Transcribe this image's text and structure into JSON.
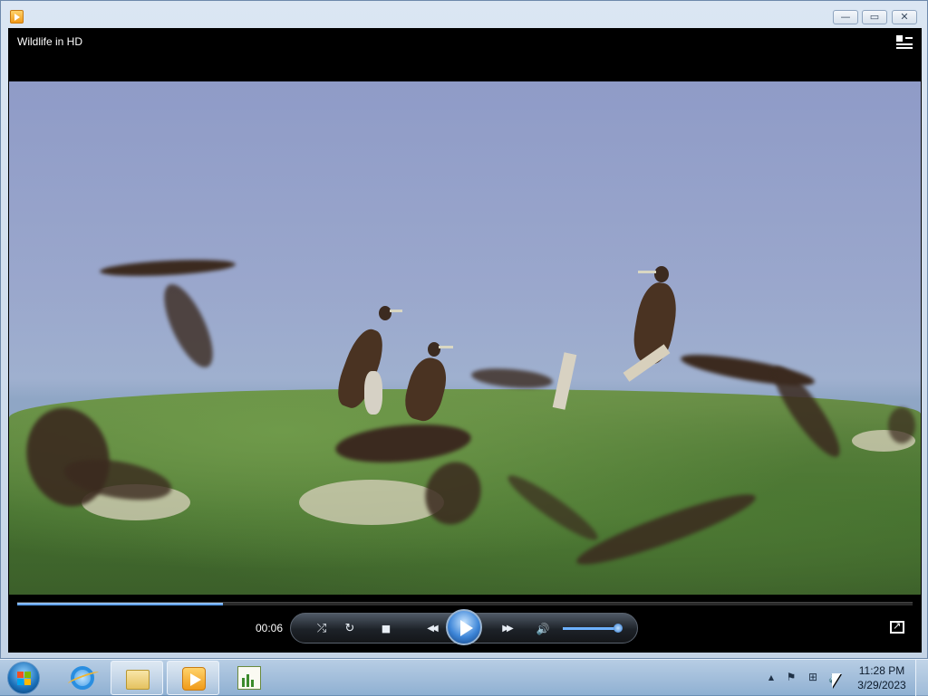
{
  "window": {
    "title_icon": "media-player-icon",
    "minimize_glyph": "—",
    "maximize_glyph": "▭",
    "close_glyph": "✕"
  },
  "player": {
    "video_title": "Wildlife in HD",
    "switch_to_library_icon": "switch-to-library-icon",
    "elapsed": "00:06",
    "seek_progress_fraction": 0.23,
    "volume_fraction": 0.95,
    "controls": {
      "shuffle_glyph": "⤮",
      "repeat_glyph": "↻",
      "stop_glyph": "■",
      "previous_glyph": "◀◀",
      "next_glyph": "▶▶",
      "mute_glyph": "🔊"
    },
    "accent_color": "#3e86d8"
  },
  "taskbar": {
    "pinned": [
      {
        "name": "internet-explorer",
        "icon": "internet-explorer-icon"
      },
      {
        "name": "windows-explorer",
        "icon": "folder-icon"
      },
      {
        "name": "windows-media-player",
        "icon": "media-player-icon"
      },
      {
        "name": "task-app",
        "icon": "chart-document-icon"
      }
    ],
    "tray": {
      "show_hidden_glyph": "▲",
      "flag_glyph": "⚑",
      "network_glyph": "⊞",
      "volume_glyph": "🔈",
      "time": "11:28 PM",
      "date": "3/29/2023"
    }
  }
}
